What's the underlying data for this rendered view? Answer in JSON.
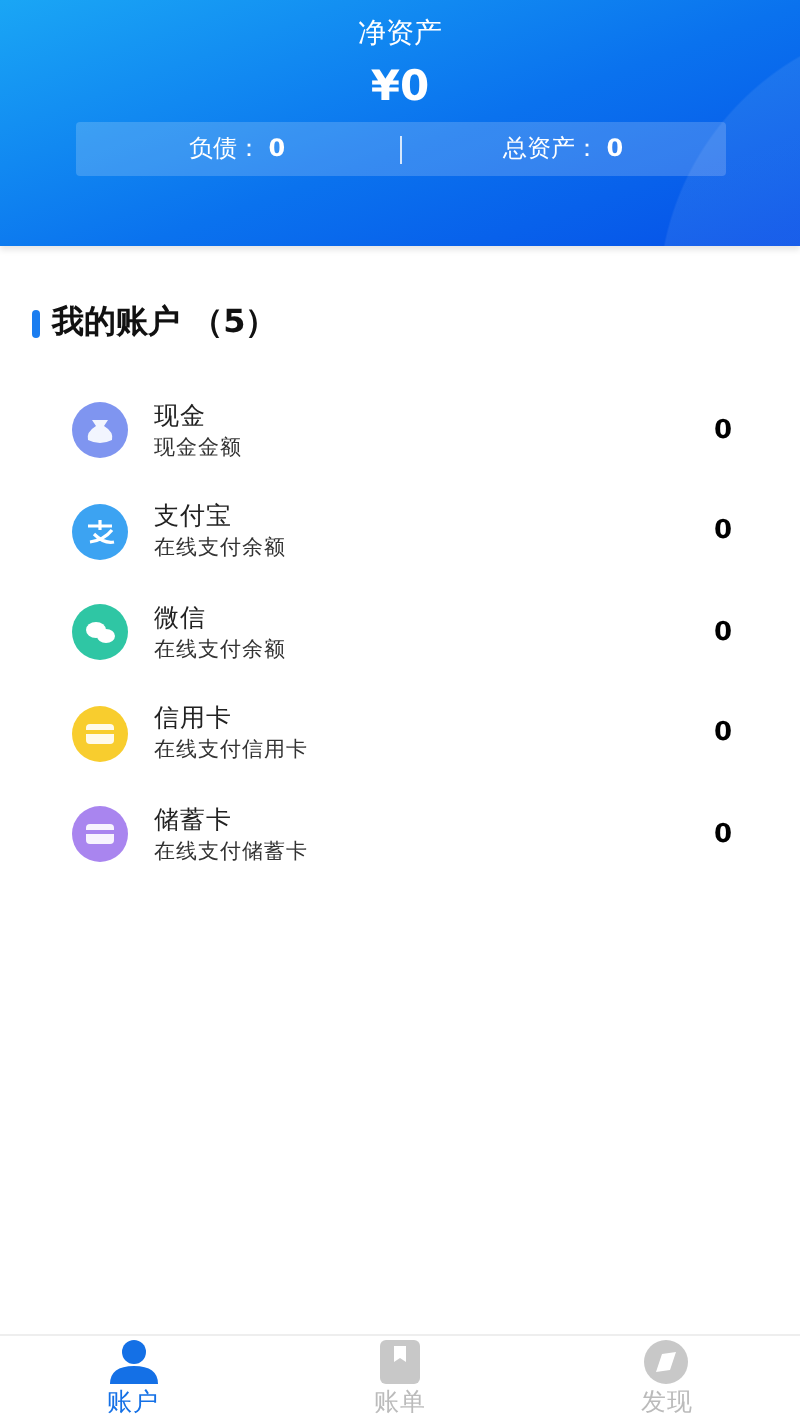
{
  "header": {
    "title": "净资产",
    "amount": "¥0",
    "stats": [
      {
        "label": "负债：",
        "value": "0"
      },
      {
        "label": "总资产：",
        "value": "0"
      }
    ]
  },
  "section": {
    "title": "我的账户",
    "count": "（5）"
  },
  "accounts": [
    {
      "kind": "cash",
      "name": "现金",
      "desc": "现金金额",
      "value": "0",
      "color": "#7f95f0"
    },
    {
      "kind": "alipay",
      "name": "支付宝",
      "desc": "在线支付余额",
      "value": "0",
      "color": "#3ca3f2"
    },
    {
      "kind": "wechat",
      "name": "微信",
      "desc": "在线支付余额",
      "value": "0",
      "color": "#2fc6a4"
    },
    {
      "kind": "card",
      "name": "信用卡",
      "desc": "在线支付信用卡",
      "value": "0",
      "color": "#f8cd2e"
    },
    {
      "kind": "card",
      "name": "储蓄卡",
      "desc": "在线支付储蓄卡",
      "value": "0",
      "color": "#a985ef"
    }
  ],
  "tabs": [
    {
      "kind": "person",
      "label": "账户",
      "selected": true
    },
    {
      "kind": "bill",
      "label": "账单",
      "selected": false
    },
    {
      "kind": "discover",
      "label": "发现",
      "selected": false
    }
  ]
}
